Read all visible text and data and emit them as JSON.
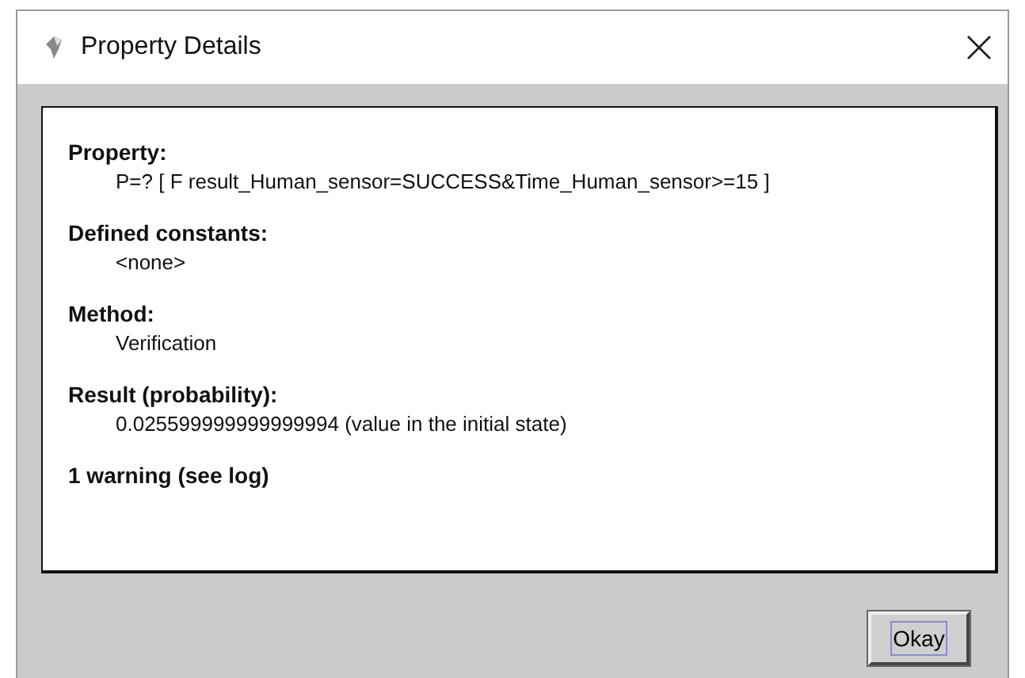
{
  "window": {
    "title": "Property Details"
  },
  "sections": [
    {
      "label": "Property:",
      "value": "P=? [ F result_Human_sensor=SUCCESS&Time_Human_sensor>=15 ]"
    },
    {
      "label": "Defined constants:",
      "value": "<none>"
    },
    {
      "label": "Method:",
      "value": "Verification"
    },
    {
      "label": "Result (probability):",
      "value": "0.025599999999999994 (value in the initial state)"
    }
  ],
  "warning": "1 warning (see log)",
  "buttons": [
    {
      "label": "Okay",
      "focused": true
    }
  ]
}
